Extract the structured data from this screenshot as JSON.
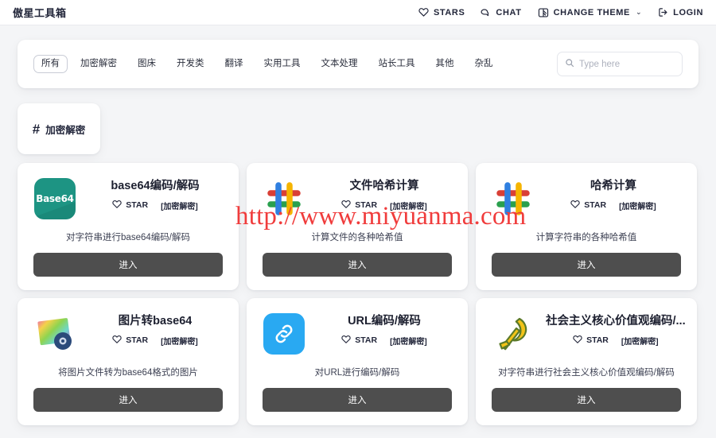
{
  "header": {
    "brand": "傲星工具箱",
    "nav": [
      {
        "label": "STARS",
        "icon": "heart-icon"
      },
      {
        "label": "CHAT",
        "icon": "chat-icon"
      },
      {
        "label": "CHANGE THEME",
        "icon": "theme-icon",
        "caret": "⌄"
      },
      {
        "label": "LOGIN",
        "icon": "login-icon"
      }
    ]
  },
  "filter": {
    "tabs": [
      "所有",
      "加密解密",
      "图床",
      "开发类",
      "翻译",
      "实用工具",
      "文本处理",
      "站长工具",
      "其他",
      "杂乱"
    ],
    "active_tab": "所有",
    "search": {
      "placeholder": "Type here",
      "value": "",
      "icon": "search-icon"
    }
  },
  "section": {
    "hash": "#",
    "title": "加密解密"
  },
  "cards": [
    {
      "title": "base64编码/解码",
      "star_label": "STAR",
      "tag": "[加密解密]",
      "desc": "对字符串进行base64编码/解码",
      "button": "进入",
      "icon": "base64-icon",
      "icon_text": "Base64",
      "icon_color": "#1d9483"
    },
    {
      "title": "文件哈希计算",
      "star_label": "STAR",
      "tag": "[加密解密]",
      "desc": "计算文件的各种哈希值",
      "button": "进入",
      "icon": "multicolor-hash-icon"
    },
    {
      "title": "哈希计算",
      "star_label": "STAR",
      "tag": "[加密解密]",
      "desc": "计算字符串的各种哈希值",
      "button": "进入",
      "icon": "multicolor-hash-icon"
    },
    {
      "title": "图片转base64",
      "star_label": "STAR",
      "tag": "[加密解密]",
      "desc": "将图片文件转为base64格式的图片",
      "button": "进入",
      "icon": "picture-icon"
    },
    {
      "title": "URL编码/解码",
      "star_label": "STAR",
      "tag": "[加密解密]",
      "desc": "对URL进行编码/解码",
      "button": "进入",
      "icon": "link-icon",
      "icon_color": "#29a9f2"
    },
    {
      "title": "社会主义核心价值观编码/...",
      "star_label": "STAR",
      "tag": "[加密解密]",
      "desc": "对字符串进行社会主义核心价值观编码/解码",
      "button": "进入",
      "icon": "hammer-sickle-icon"
    }
  ],
  "watermark": {
    "text": "http://www.miyuanma.com",
    "color": "#f03c3c"
  }
}
